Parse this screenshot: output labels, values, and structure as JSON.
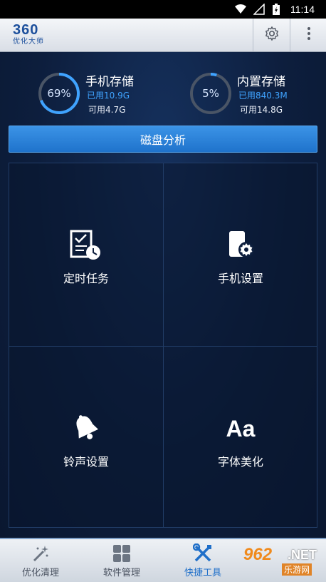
{
  "status_bar": {
    "time": "11:14"
  },
  "header": {
    "logo_main": "360",
    "logo_sub": "优化大师",
    "icons": [
      "settings-gear-icon",
      "more-vertical-icon"
    ]
  },
  "storage": {
    "phone": {
      "percent": "69%",
      "percent_value": 69,
      "title": "手机存储",
      "used": "已用10.9G",
      "available": "可用4.7G"
    },
    "internal": {
      "percent": "5%",
      "percent_value": 5,
      "title": "内置存储",
      "used": "已用840.3M",
      "available": "可用14.8G"
    }
  },
  "disk_analysis_label": "磁盘分析",
  "tools": [
    {
      "label": "定时任务",
      "icon": "scheduled-task-icon"
    },
    {
      "label": "手机设置",
      "icon": "phone-settings-icon"
    },
    {
      "label": "铃声设置",
      "icon": "bell-icon"
    },
    {
      "label": "字体美化",
      "icon": "font-aa-icon",
      "glyph": "Aa"
    }
  ],
  "bottom_nav": [
    {
      "label": "优化清理",
      "icon": "magic-wand-icon"
    },
    {
      "label": "软件管理",
      "icon": "grid-apps-icon"
    },
    {
      "label": "快捷工具",
      "icon": "tools-icon",
      "active": true
    }
  ],
  "watermark": {
    "num": "962",
    "net": ".NET",
    "site": "乐游网"
  },
  "colors": {
    "accent": "#1f73cc",
    "ring_active": "#3fa3ff",
    "ring_track": "#4a5566"
  }
}
